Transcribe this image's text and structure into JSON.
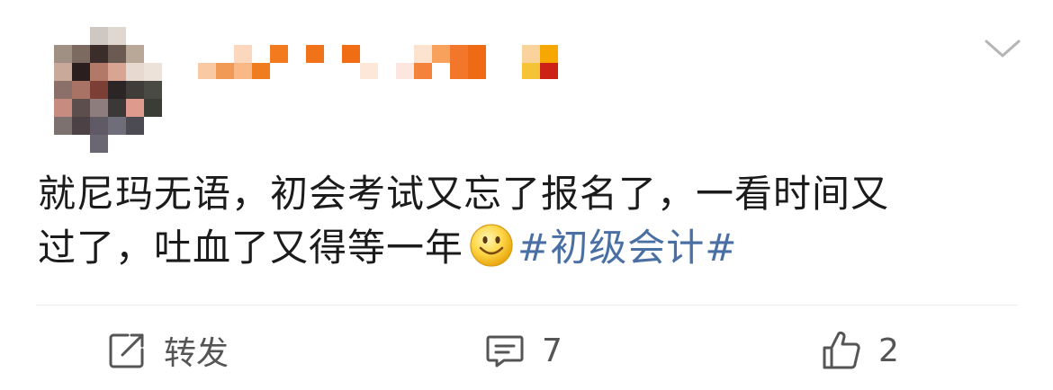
{
  "post": {
    "text_line1": "就尼玛无语，初会考试又忘了报名了，一看时间又",
    "text_line2": "过了，吐血了又得等一年",
    "emoji": "smile-emoji",
    "hashtag": "#初级会计#"
  },
  "actions": {
    "repost_label": "转发",
    "comment_count": "7",
    "like_count": "2"
  },
  "colors": {
    "hashtag": "#4a6fa5",
    "action": "#555555",
    "divider": "#ececec",
    "username_mosaic_primary": "#f07a1a"
  },
  "icons": {
    "repost": "share-edit-icon",
    "comment": "comment-bubble-icon",
    "like": "thumbs-up-icon",
    "menu": "chevron-down-icon"
  }
}
